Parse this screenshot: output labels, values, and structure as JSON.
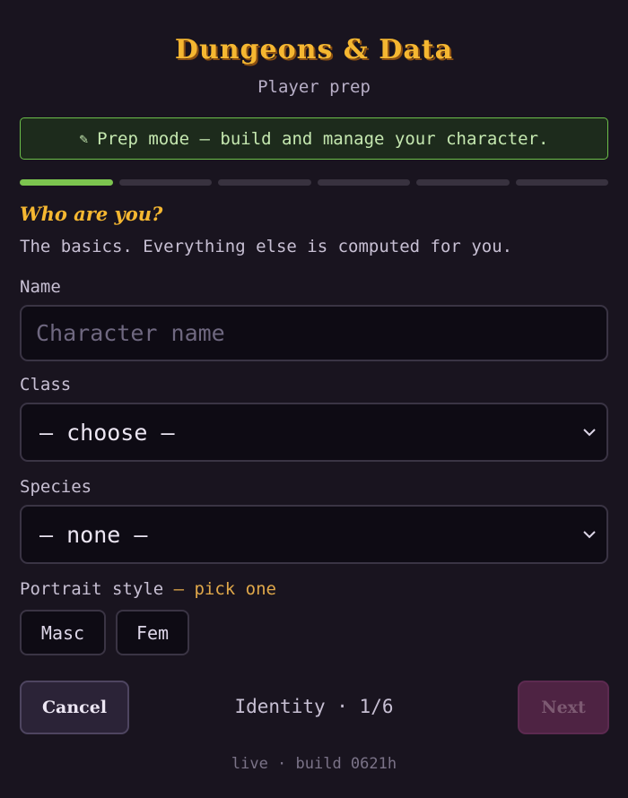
{
  "header": {
    "title": "Dungeons & Data",
    "subtitle": "Player prep"
  },
  "banner": {
    "icon": "pencil-icon",
    "text": "Prep mode — build and manage your character."
  },
  "progress": {
    "total_steps": 6,
    "current_step": 1,
    "active_color": "#7cc44f",
    "inactive_color": "#38323f"
  },
  "step": {
    "title": "Who are you?",
    "description": "The basics. Everything else is computed for you."
  },
  "fields": {
    "name": {
      "label": "Name",
      "value": "",
      "placeholder": "Character name"
    },
    "class": {
      "label": "Class",
      "value": "— choose —"
    },
    "species": {
      "label": "Species",
      "value": "— none —"
    },
    "portrait": {
      "label": "Portrait style",
      "hint": "— pick one",
      "options": [
        "Masc",
        "Fem"
      ]
    }
  },
  "nav": {
    "cancel_label": "Cancel",
    "step_indicator": "Identity · 1/6",
    "next_label": "Next"
  },
  "footer": {
    "status": "live · build 0621h"
  },
  "colors": {
    "background": "#19141f",
    "accent_gold": "#f5b731",
    "banner_border": "#6cbf4a",
    "next_button": "#4e2343"
  }
}
